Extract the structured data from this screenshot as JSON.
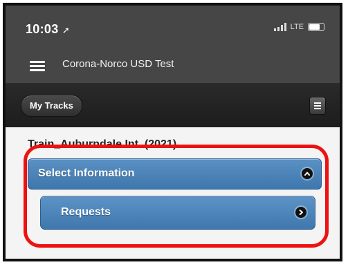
{
  "status_bar": {
    "time": "10:03",
    "location_glyph": "➚",
    "network": "LTE"
  },
  "header": {
    "title": "Corona-Norco USD Test"
  },
  "toolbar": {
    "my_tracks_label": "My Tracks"
  },
  "content": {
    "section_title": "Train_Auburndale Int. (2021)",
    "collapsible": {
      "label": "Select Information",
      "icon": "chevron-up-icon"
    },
    "items": [
      {
        "label": "Requests",
        "icon": "chevron-right-icon"
      }
    ]
  },
  "colors": {
    "header_bg": "#464646",
    "toolbar_bg": "#1d1d1d",
    "accent_blue": "#4a82b8",
    "highlight_red": "#ee1111"
  }
}
